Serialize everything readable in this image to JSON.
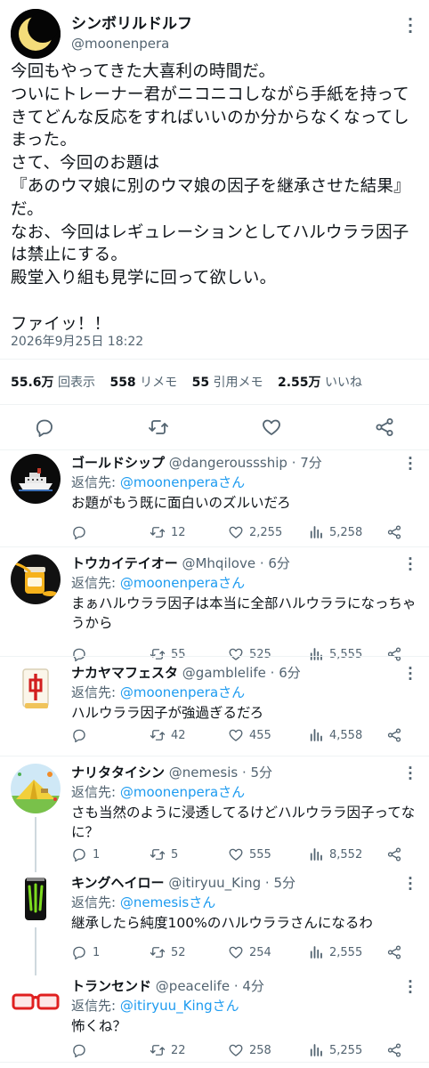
{
  "tweet": {
    "display_name": "シンボリルドルフ",
    "handle": "@moonenpera",
    "text": "今回もやってきた大喜利の時間だ。\nついにトレーナー君がニコニコしながら手紙を持ってきてどんな反応をすればいいのか分からなくなってしまった。\nさて、今回のお題は\n『あのウマ娘に別のウマ娘の因子を継承させた結果』だ。\nなお、今回はレギュレーションとしてハルウララ因子は禁止にする。\n殿堂入り組も見学に回って欲しい。\n\nファイッ！！",
    "timestamp": "2026年9月25日 18:22",
    "stats": [
      {
        "value": "55.6万",
        "label": "回表示"
      },
      {
        "value": "558",
        "label": "リメモ"
      },
      {
        "value": "55",
        "label": "引用メモ"
      },
      {
        "value": "2.55万",
        "label": "いいね"
      }
    ]
  },
  "icons": {
    "main_actions": [
      "reply-icon",
      "retweet-icon",
      "like-icon",
      "share-icon"
    ],
    "reply_actions": [
      "reply-icon",
      "retweet-icon",
      "like-icon",
      "views-icon",
      "share-icon"
    ]
  },
  "replies": [
    {
      "name": "ゴールドシップ",
      "handle": "@dangeroussship",
      "time": "7分",
      "reply_to_label": "返信先: ",
      "reply_to": "@moonenperaさん",
      "text": "お題がもう既に面白いのズルいだろ",
      "replies": "",
      "retweets": "12",
      "likes": "2,255",
      "views": "5,258"
    },
    {
      "name": "トウカイテイオー",
      "handle": "@Mhqilove",
      "time": "6分",
      "reply_to_label": "返信先: ",
      "reply_to": "@moonenperaさん",
      "text": "まぁハルウララ因子は本当に全部ハルウララになっちゃうから",
      "replies": "",
      "retweets": "55",
      "likes": "525",
      "views": "5,555"
    },
    {
      "name": "ナカヤマフェスタ",
      "handle": "@gamblelife",
      "time": "6分",
      "reply_to_label": "返信先: ",
      "reply_to": "@moonenperaさん",
      "text": "ハルウララ因子が強過ぎるだろ",
      "replies": "",
      "retweets": "42",
      "likes": "455",
      "views": "4,558"
    },
    {
      "name": "ナリタタイシン",
      "handle": "@nemesis",
      "time": "5分",
      "reply_to_label": "返信先: ",
      "reply_to": "@moonenperaさん",
      "text": "さも当然のように浸透してるけどハルウララ因子ってなに？",
      "replies": "1",
      "retweets": "5",
      "likes": "555",
      "views": "8,552"
    },
    {
      "name": "キングヘイロー",
      "handle": "@itiryuu_King",
      "time": "5分",
      "reply_to_label": "返信先: ",
      "reply_to": "@nemesisさん",
      "text": "継承したら純度100%のハルウララさんになるわ",
      "replies": "1",
      "retweets": "52",
      "likes": "254",
      "views": "2,555"
    },
    {
      "name": "トランセンド",
      "handle": "@peacelife",
      "time": "4分",
      "reply_to_label": "返信先: ",
      "reply_to": "@itiryuu_Kingさん",
      "text": "怖くね？",
      "replies": "",
      "retweets": "22",
      "likes": "258",
      "views": "5,255"
    }
  ],
  "colors": {
    "text": "#0f1419",
    "secondary": "#536471",
    "link": "#1d9bf0",
    "divider": "#eff3f4"
  }
}
